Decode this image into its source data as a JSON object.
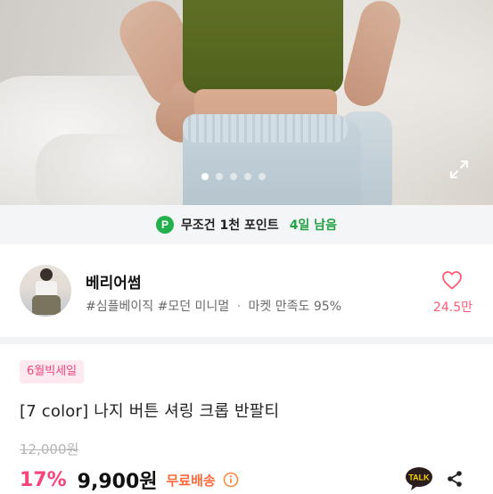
{
  "product_image": {
    "carousel_dot_count": 5,
    "active_dot_index": 0
  },
  "points_banner": {
    "badge": "P",
    "text": "무조건 1천 포인트",
    "days_left": "4일 남음"
  },
  "shop": {
    "name": "베리어썸",
    "tags": [
      "#심플베이직",
      "#모던 미니멀"
    ],
    "separator": "·",
    "satisfaction": "마켓 만족도 95%",
    "like_count": "24.5만"
  },
  "product": {
    "sale_badge": "6월빅세일",
    "title": "[7 color] 나지 버튼 셔링 크롭 반팔티",
    "original_price": "12,000원",
    "discount": "17%",
    "price": "9,900원",
    "shipping": "무료배송"
  },
  "actions": {
    "kakao_label": "TALK"
  },
  "colors": {
    "accent_pink": "#f5457a",
    "points_green": "#22a346",
    "shipping_orange": "#ff6a3d"
  }
}
